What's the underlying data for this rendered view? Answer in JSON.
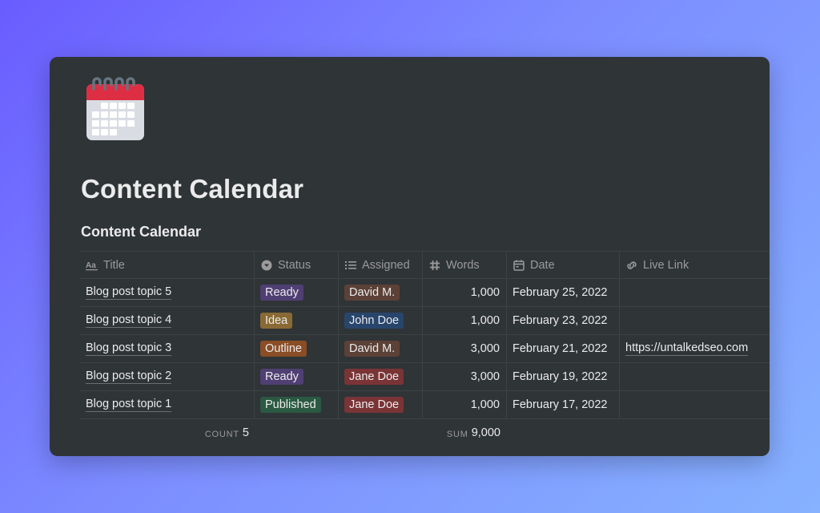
{
  "page": {
    "title": "Content Calendar",
    "icon": "calendar-icon"
  },
  "database": {
    "title": "Content Calendar",
    "columns": [
      {
        "label": "Title",
        "icon": "text-aa-icon"
      },
      {
        "label": "Status",
        "icon": "select-chevron-icon"
      },
      {
        "label": "Assigned",
        "icon": "list-icon"
      },
      {
        "label": "Words",
        "icon": "hash-icon"
      },
      {
        "label": "Date",
        "icon": "calendar-small-icon"
      },
      {
        "label": "Live Link",
        "icon": "link-icon"
      }
    ],
    "rows": [
      {
        "title": "Blog post topic 5",
        "status": "Ready",
        "status_color": "#4f3f73",
        "assigned": "David M.",
        "assigned_color": "#5c4137",
        "words": "1,000",
        "date": "February 25, 2022",
        "link": ""
      },
      {
        "title": "Blog post topic 4",
        "status": "Idea",
        "status_color": "#8a6a34",
        "assigned": "John Doe",
        "assigned_color": "#28456c",
        "words": "1,000",
        "date": "February 23, 2022",
        "link": ""
      },
      {
        "title": "Blog post topic 3",
        "status": "Outline",
        "status_color": "#8a4d25",
        "assigned": "David M.",
        "assigned_color": "#5c4137",
        "words": "3,000",
        "date": "February 21, 2022",
        "link": "https://untalkedseo.com"
      },
      {
        "title": "Blog post topic 2",
        "status": "Ready",
        "status_color": "#4f3f73",
        "assigned": "Jane Doe",
        "assigned_color": "#7a3436",
        "words": "3,000",
        "date": "February 19, 2022",
        "link": ""
      },
      {
        "title": "Blog post topic 1",
        "status": "Published",
        "status_color": "#2b5942",
        "assigned": "Jane Doe",
        "assigned_color": "#7a3436",
        "words": "1,000",
        "date": "February 17, 2022",
        "link": ""
      }
    ],
    "footer": {
      "count_label": "COUNT",
      "count_value": "5",
      "sum_label": "SUM",
      "sum_value": "9,000"
    }
  }
}
